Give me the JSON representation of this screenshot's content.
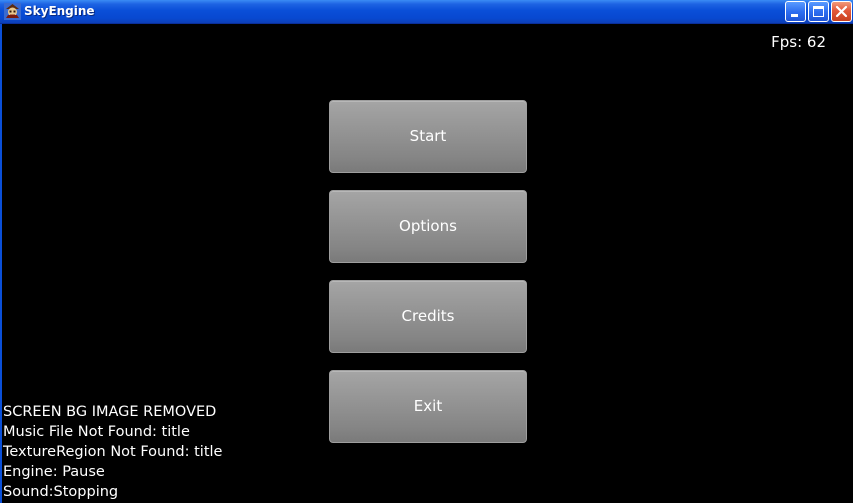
{
  "window": {
    "title": "SkyEngine"
  },
  "hud": {
    "fps": "Fps: 62"
  },
  "menu": {
    "buttons": [
      {
        "label": "Start"
      },
      {
        "label": "Options"
      },
      {
        "label": "Credits"
      },
      {
        "label": "Exit"
      }
    ]
  },
  "debug": {
    "lines": [
      "SCREEN BG IMAGE REMOVED",
      "Music File Not Found: title",
      "TextureRegion Not Found: title",
      "Engine: Pause",
      "Sound:Stopping"
    ]
  },
  "icons": {
    "app": "pirate-skull-icon",
    "minimize": "minimize-icon",
    "maximize": "maximize-icon",
    "close": "close-icon"
  },
  "colors": {
    "titlebar": "#0a4fd8",
    "button_face": "#959595",
    "close_button": "#e2583a",
    "background": "#000000",
    "text": "#ffffff"
  }
}
